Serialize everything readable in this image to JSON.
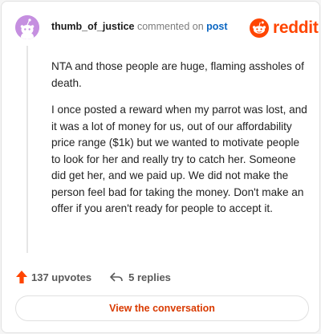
{
  "comment": {
    "username": "thumb_of_justice",
    "action_text": "commented on",
    "post_link_label": "post",
    "paragraphs": [
      "NTA and those people are huge, flaming assholes of death.",
      "I once posted a reward when my parrot was lost, and it was a lot of money for us, out of our affordability price range ($1k) but we wanted to motivate people to look for her and really try to catch her. Someone did get her, and we paid up. We did not make the person feel bad for taking the money. Don't make an offer if you aren't ready for people to accept it."
    ],
    "upvotes_label": "137 upvotes",
    "replies_label": "5 replies"
  },
  "brand": {
    "wordmark": "reddit",
    "color": "#ff4500"
  },
  "actions": {
    "view_conversation_label": "View the conversation"
  },
  "colors": {
    "avatar_bg": "#c58fe0",
    "link": "#0a66c2",
    "cta_text": "#d93a00"
  },
  "icons": [
    "snoo-avatar-icon",
    "reddit-logo-icon",
    "upvote-arrow-icon",
    "reply-arrow-icon"
  ]
}
